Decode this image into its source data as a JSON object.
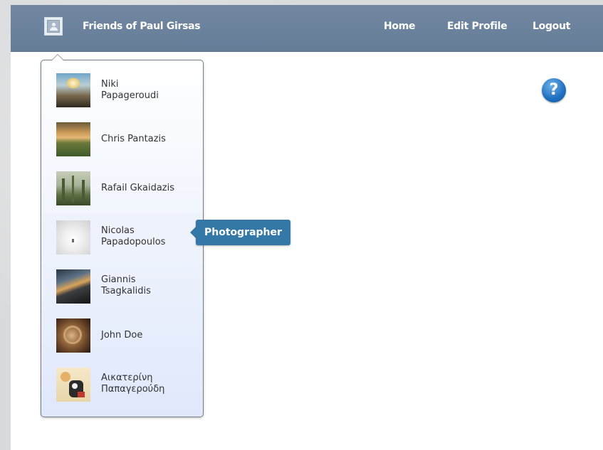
{
  "header": {
    "site_title": "Friends of Paul Girsas",
    "nav": {
      "home": "Home",
      "edit_profile": "Edit Profile",
      "logout": "Logout"
    }
  },
  "help": {
    "label": "?"
  },
  "friends": [
    {
      "name_line1": "Niki",
      "name_line2": "Papageroudi"
    },
    {
      "name_line1": "Chris Pantazis",
      "name_line2": ""
    },
    {
      "name_line1": "Rafail Gkaidazis",
      "name_line2": ""
    },
    {
      "name_line1": "Nicolas",
      "name_line2": "Papadopoulos"
    },
    {
      "name_line1": "Giannis",
      "name_line2": "Tsagkalidis"
    },
    {
      "name_line1": "John Doe",
      "name_line2": ""
    },
    {
      "name_line1": "Αικατερίνη",
      "name_line2": "Παπαγερούδη"
    }
  ],
  "tooltip": {
    "text": "Photographer"
  }
}
